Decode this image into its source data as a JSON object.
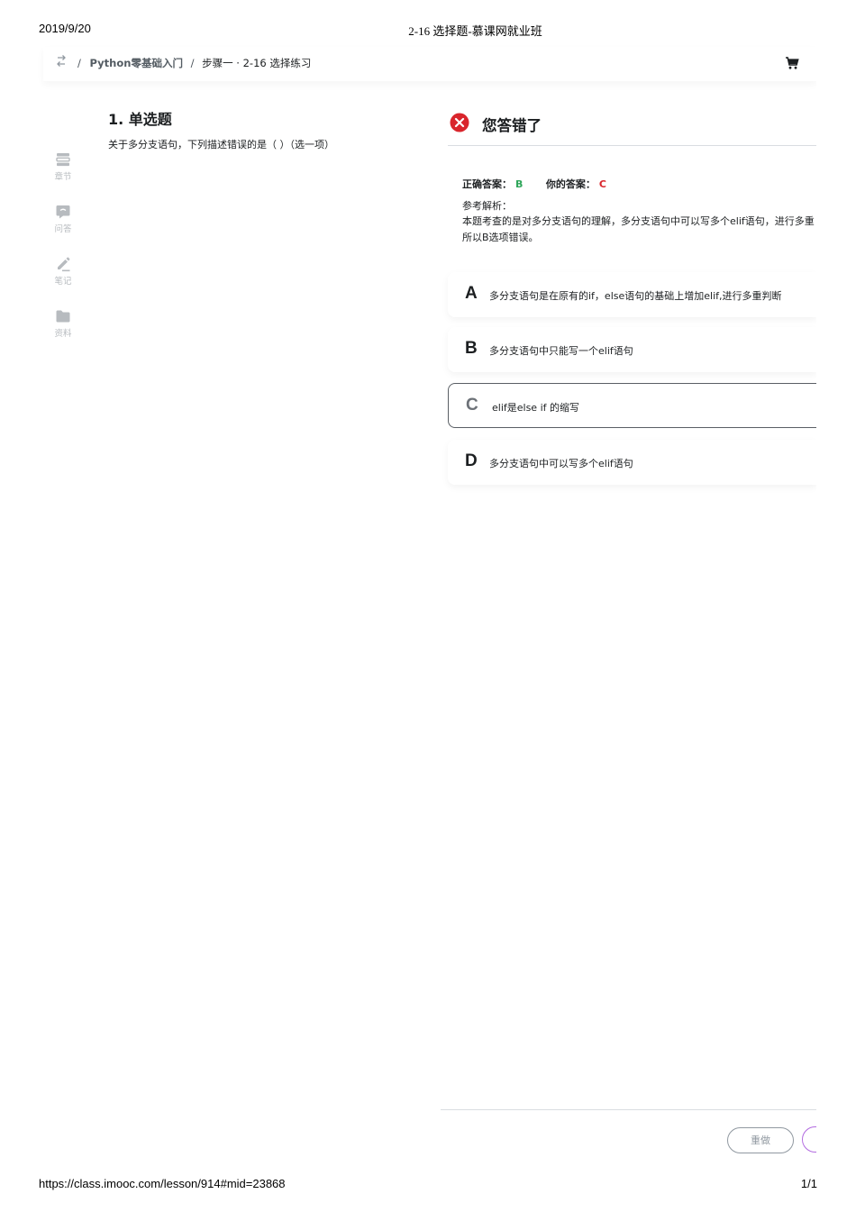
{
  "print": {
    "date": "2019/9/20",
    "title": "2-16 选择题-慕课网就业班",
    "url": "https://class.imooc.com/lesson/914#mid=23868",
    "page": "1/1"
  },
  "breadcrumb": {
    "sep1": "/",
    "course": "Python零基础入门",
    "sep2": "/",
    "current": "步骤一 · 2-16 选择练习"
  },
  "sidebar": {
    "items": [
      {
        "label": "章节",
        "icon": "chapter-icon"
      },
      {
        "label": "问答",
        "icon": "qa-icon"
      },
      {
        "label": "笔记",
        "icon": "note-icon"
      },
      {
        "label": "资料",
        "icon": "folder-icon"
      }
    ]
  },
  "question": {
    "title": "1. 单选题",
    "text": "关于多分支语句，下列描述错误的是（ ）（选一项）"
  },
  "result": {
    "title": "您答错了",
    "correct_label": "正确答案：",
    "correct_value": "B",
    "yours_label": "你的答案：",
    "yours_value": "C",
    "analysis_label": "参考解析：",
    "analysis_line1": "本题考查的是对多分支语句的理解，多分支语句中可以写多个elif语句，进行多重",
    "analysis_line2": "所以B选项错误。"
  },
  "options": [
    {
      "letter": "A",
      "text": "多分支语句是在原有的if，else语句的基础上增加elif,进行多重判断"
    },
    {
      "letter": "B",
      "text": "多分支语句中只能写一个elif语句"
    },
    {
      "letter": "C",
      "text": "elif是else if 的缩写",
      "selected": true
    },
    {
      "letter": "D",
      "text": "多分支语句中可以写多个elif语句"
    }
  ],
  "actions": {
    "redo": "重做"
  },
  "colors": {
    "correct": "#2fa65a",
    "wrong": "#d9252c",
    "next_button_border": "#b26be0"
  }
}
